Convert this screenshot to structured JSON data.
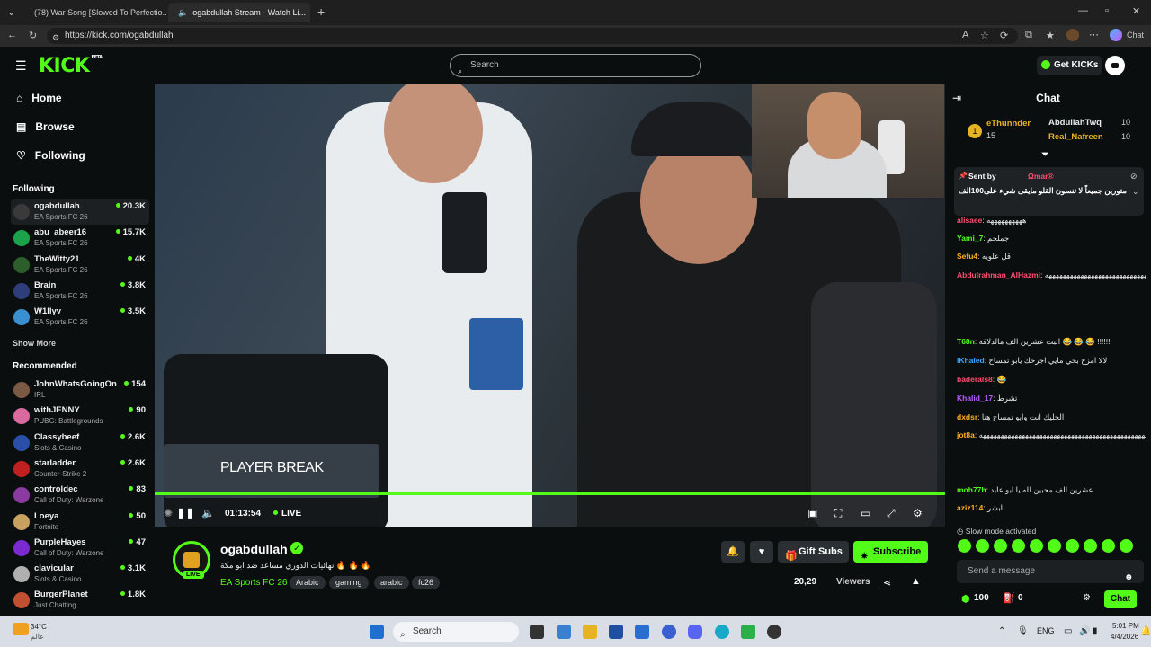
{
  "browser": {
    "tabs": [
      {
        "title": "(78) War Song [Slowed To Perfectio...",
        "icon": "youtube-icon"
      },
      {
        "title": "ogabdullah Stream - Watch Li...",
        "icon": "kick-icon"
      }
    ],
    "url": "https://kick.com/ogabdullah",
    "profile_chat": "Chat"
  },
  "header": {
    "logo": "KICK",
    "logo_beta": "BETA",
    "search_placeholder": "Search",
    "get_kicks": "Get KICKs"
  },
  "sidebar": {
    "nav": [
      {
        "label": "Home",
        "icon": "home-icon"
      },
      {
        "label": "Browse",
        "icon": "browse-icon"
      },
      {
        "label": "Following",
        "icon": "heart-icon"
      }
    ],
    "following_title": "Following",
    "following": [
      {
        "name": "ogabdullah",
        "category": "EA Sports FC 26",
        "viewers": "20.3K",
        "color": "#3a3a3a"
      },
      {
        "name": "abu_abeer16",
        "category": "EA Sports FC 26",
        "viewers": "15.7K",
        "color": "#1aa34a"
      },
      {
        "name": "TheWitty21",
        "category": "EA Sports FC 26",
        "viewers": "4K",
        "color": "#2b5e2b"
      },
      {
        "name": "Brain",
        "category": "EA Sports FC 26",
        "viewers": "3.8K",
        "color": "#2f3e7a"
      },
      {
        "name": "W1llyv",
        "category": "EA Sports FC 26",
        "viewers": "3.5K",
        "color": "#3a8fd0"
      }
    ],
    "show_more": "Show More",
    "recommended_title": "Recommended",
    "recommended": [
      {
        "name": "JohnWhatsGoingOn",
        "category": "IRL",
        "viewers": "154",
        "color": "#7a5a44"
      },
      {
        "name": "withJENNY",
        "category": "PUBG: Battlegrounds",
        "viewers": "90",
        "color": "#d96aa0"
      },
      {
        "name": "Classybeef",
        "category": "Slots & Casino",
        "viewers": "2.6K",
        "color": "#2a4fa8"
      },
      {
        "name": "starladder",
        "category": "Counter-Strike 2",
        "viewers": "2.6K",
        "color": "#c02020"
      },
      {
        "name": "controldec",
        "category": "Call of Duty: Warzone",
        "viewers": "83",
        "color": "#8a3aa0"
      },
      {
        "name": "Loeya",
        "category": "Fortnite",
        "viewers": "50",
        "color": "#c8a060"
      },
      {
        "name": "PurpleHayes",
        "category": "Call of Duty: Warzone",
        "viewers": "47",
        "color": "#7a2ad0"
      },
      {
        "name": "clavicular",
        "category": "Slots & Casino",
        "viewers": "3.1K",
        "color": "#b0b0b0"
      },
      {
        "name": "BurgerPlanet",
        "category": "Just Chatting",
        "viewers": "1.8K",
        "color": "#c05030"
      }
    ]
  },
  "player": {
    "overlay_text": "PLAYER BREAK",
    "time": "01:13:54",
    "live_label": "LIVE",
    "progress": 1.0
  },
  "stream": {
    "live_badge": "LIVE",
    "streamer": "ogabdullah",
    "title": "نهائيات الدوري مساعد ضد ابو مكة 🔥 🔥 🔥",
    "category": "EA Sports FC 26",
    "tags": [
      "Arabic",
      "gaming",
      "arabic",
      "fc26"
    ],
    "gift_subs": "Gift Subs",
    "subscribe": "Subscribe",
    "viewers": "20,29",
    "viewers_label": "Viewers"
  },
  "chat": {
    "title": "Chat",
    "top_gifters": [
      {
        "name": "eThunnder",
        "count": "15",
        "color": "#e6b422"
      },
      {
        "name": "AbdullahTwq",
        "count": "10",
        "color": "#e8e8e8"
      },
      {
        "name": "Real_Nafreen",
        "count": "10",
        "color": "#e6b422"
      }
    ],
    "pinned_sent_by": "Sent by",
    "pinned_user": "Ωmar®",
    "pinned_message": "متورين جميعاً لا تنسون القلو مايقى شيء على100الف",
    "messages": [
      {
        "user": "alisaee",
        "text": "ههههههههههه",
        "color": "#ff4d6d"
      },
      {
        "user": "Yami_7",
        "text": "جملجم",
        "color": "#53fc18"
      },
      {
        "user": "Sefu4",
        "text": "قل علويه",
        "color": "#ffb020"
      },
      {
        "user": "Abdulrahman_AlHazmi",
        "text": "ههههههههههههههههههههههههههههههههههههههههههههههههههههههههههههههههههههه",
        "color": "#ff4d6d"
      },
      {
        "user": "T68n",
        "text": "البت عشرين الف مالدلافة 😂 😂 😂 !!!!!!",
        "color": "#53fc18"
      },
      {
        "user": "lKhaled",
        "text": "لالا امزح بحي مايي اجرحك يابو تمساح",
        "color": "#3ba3ff"
      },
      {
        "user": "baderals8",
        "text": "😂",
        "color": "#ff4d6d"
      },
      {
        "user": "Khalid_17",
        "text": "تشرط",
        "color": "#b65cff"
      },
      {
        "user": "dxdsr",
        "text": "الخليك انت وابو تمساح هنا",
        "color": "#ffb020"
      },
      {
        "user": "jot8a",
        "text": "ههههههههههههههههههههههههههههههههههههههههههههههههههههههههههههههههههههه",
        "color": "#ffb020"
      },
      {
        "user": "moh77h",
        "text": "عشرين الف محبين لله يا ابو عابد",
        "color": "#53fc18"
      },
      {
        "user": "aziz114",
        "text": "ابشر",
        "color": "#ffb020"
      }
    ],
    "slow_mode": "Slow mode activated",
    "input_placeholder": "Send a message",
    "kicks_count": "100",
    "points": "0",
    "send_button": "Chat"
  },
  "taskbar": {
    "weather_temp": "34°C",
    "weather_desc": "عالم",
    "search": "Search",
    "lang": "ENG",
    "time": "5:01 PM",
    "date": "4/4/2026"
  }
}
